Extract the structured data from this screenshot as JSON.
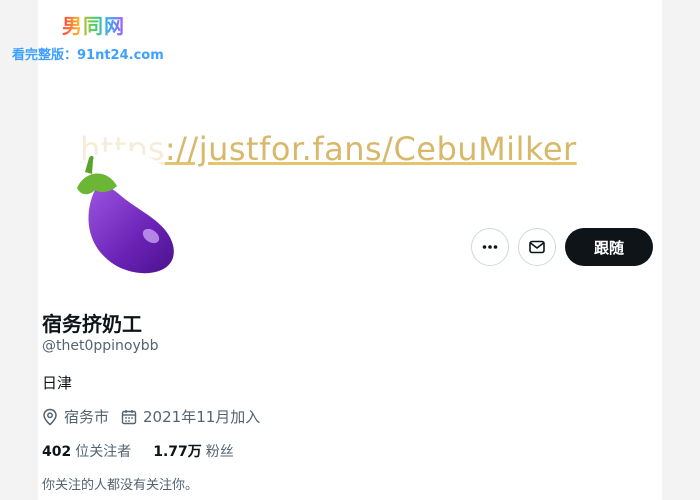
{
  "watermark": {
    "title": "男同网",
    "subtitle": "看完整版：91nt24.com"
  },
  "banner": {
    "link_prefix": "https",
    "link_text": "://justfor.fans/CebuMilker"
  },
  "profile": {
    "avatar_icon": "eggplant-icon",
    "display_name": "宿务挤奶工",
    "handle": "@thet0ppinoybb",
    "bio": "日津",
    "location": "宿务市",
    "joined": "2021年11月加入",
    "following_count": "402",
    "following_label": "位关注者",
    "followers_count": "1.77万",
    "followers_label": "粉丝",
    "note": "你关注的人都没有关注你。"
  },
  "actions": {
    "more_icon": "more-icon",
    "message_icon": "message-icon",
    "follow_label": "跟随"
  },
  "colors": {
    "accent_dark": "#0f1419",
    "secondary_text": "#536471",
    "banner_link": "#d8b86a",
    "eggplant": "#7b2fc4"
  }
}
